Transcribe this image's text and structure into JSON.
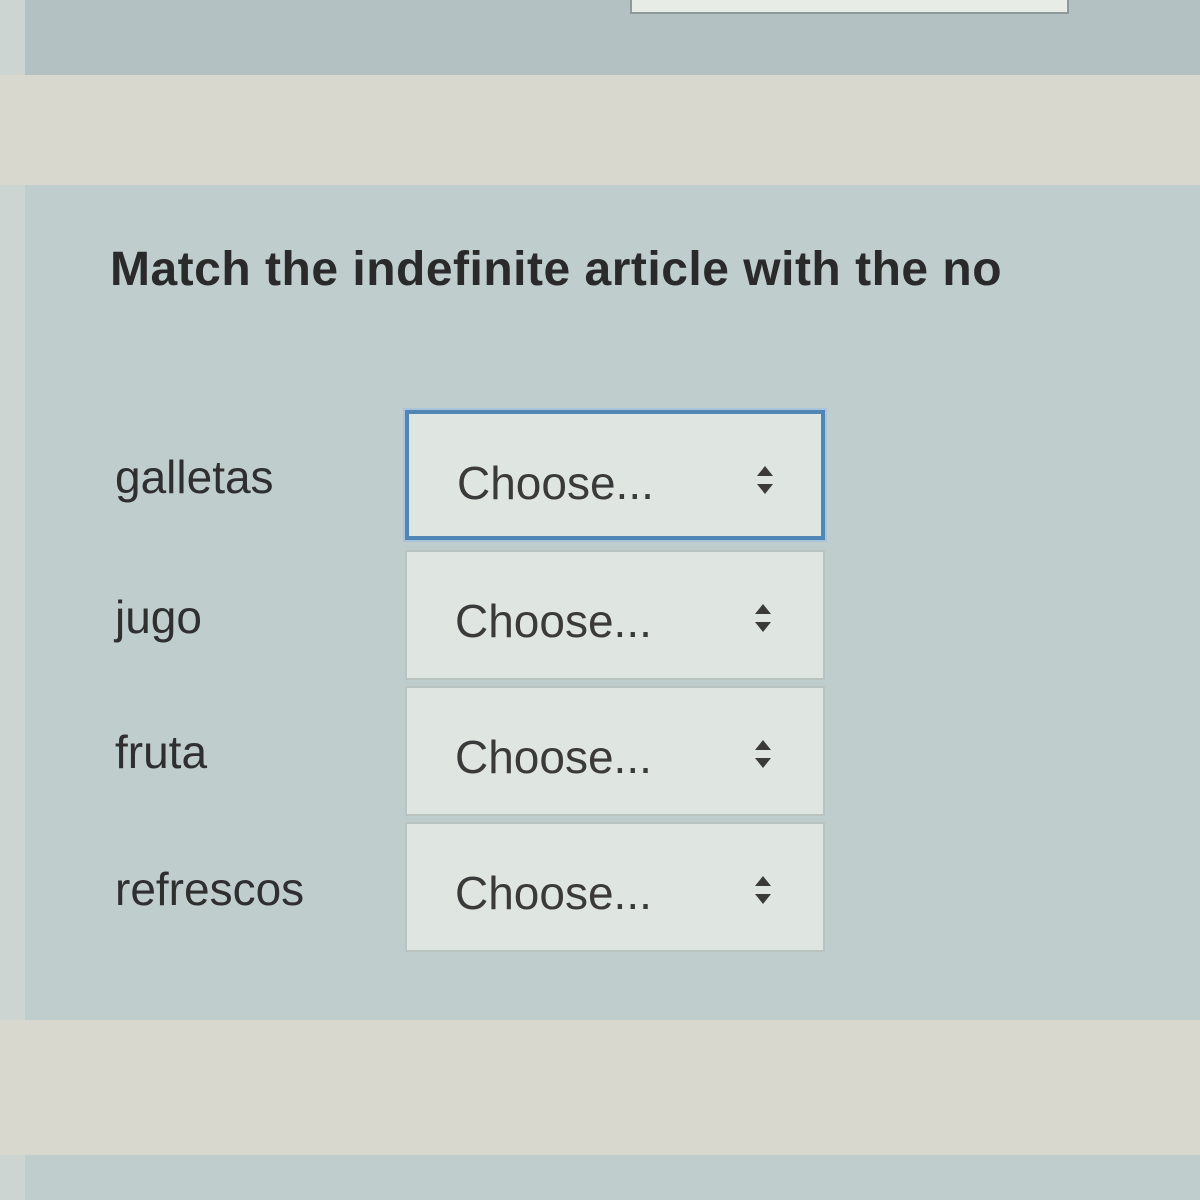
{
  "prompt": "Match the indefinite article with the no",
  "placeholder": "Choose...",
  "rows": [
    {
      "noun": "galletas",
      "selected": "Choose..."
    },
    {
      "noun": "jugo",
      "selected": "Choose..."
    },
    {
      "noun": "fruta",
      "selected": "Choose..."
    },
    {
      "noun": "refrescos",
      "selected": "Choose..."
    }
  ],
  "colors": {
    "panel": "#bfcdcd",
    "band": "#d9d8cf",
    "select_bg": "#dfe6e2",
    "focus_border": "#4f86b5"
  },
  "icons": {
    "select_arrow": "up-down-chevron-icon"
  }
}
